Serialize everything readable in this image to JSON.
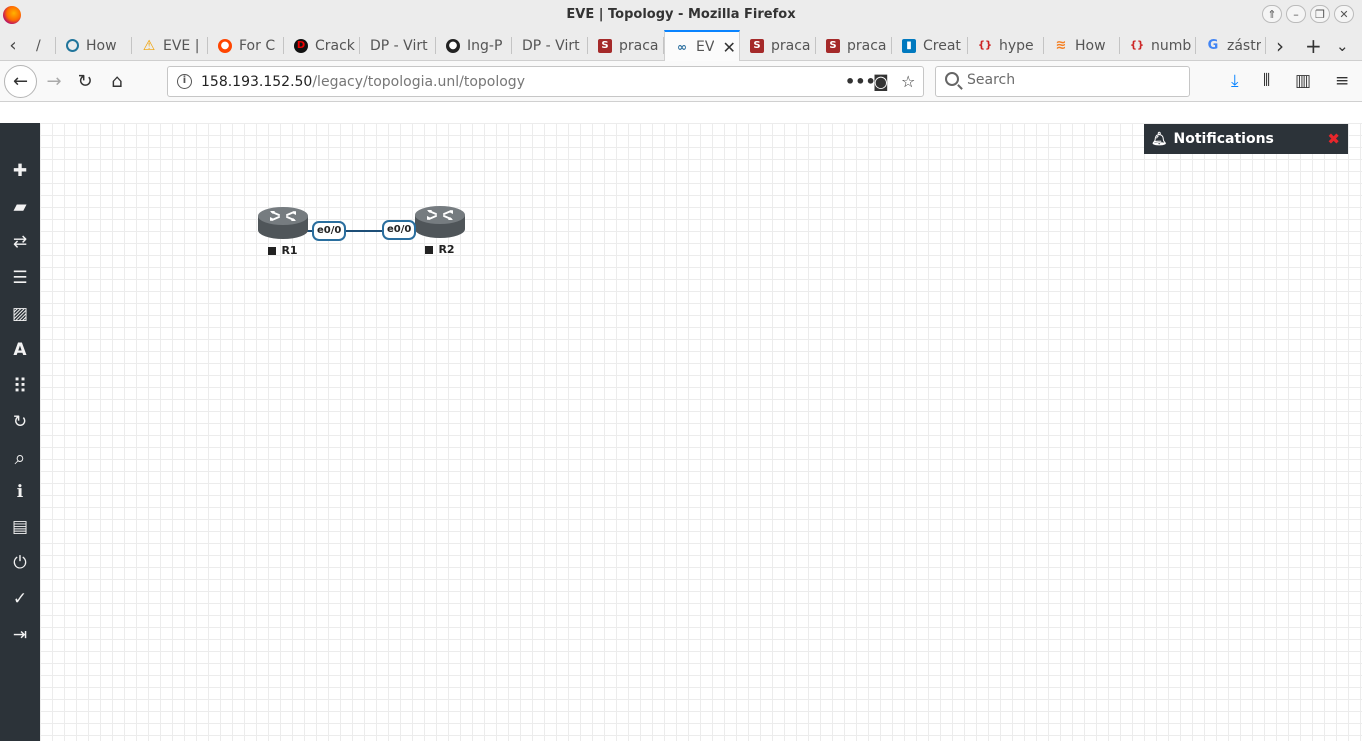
{
  "window": {
    "title": "EVE | Topology - Mozilla Firefox",
    "controls": [
      "⇑",
      "–",
      "❐",
      "✕"
    ]
  },
  "tabs": [
    {
      "label": "/",
      "favicon": "partial-icon",
      "color": "#888888"
    },
    {
      "label": "How",
      "favicon": "wordpress-icon",
      "color": "#21759b"
    },
    {
      "label": "EVE |",
      "favicon": "warning-icon",
      "color": "#f0a000"
    },
    {
      "label": "For C",
      "favicon": "reddit-icon",
      "color": "#ff4500"
    },
    {
      "label": "Crack",
      "favicon": "d-icon",
      "color": "#cc0000"
    },
    {
      "label": "DP - Virt",
      "favicon": "none",
      "color": ""
    },
    {
      "label": "Ing-P",
      "favicon": "github-icon",
      "color": "#222222"
    },
    {
      "label": "DP - Virt",
      "favicon": "none",
      "color": ""
    },
    {
      "label": "praca",
      "favicon": "s-icon",
      "color": "#a52a2a"
    },
    {
      "label": "EV",
      "favicon": "eve-icon",
      "color": "#2a6e9e",
      "active": true
    },
    {
      "label": "praca",
      "favicon": "s-icon",
      "color": "#a52a2a"
    },
    {
      "label": "praca",
      "favicon": "s-icon",
      "color": "#a52a2a"
    },
    {
      "label": "Creat",
      "favicon": "trello-icon",
      "color": "#0079bf"
    },
    {
      "label": "hype",
      "favicon": "braces-icon",
      "color": "#cc2222"
    },
    {
      "label": "How",
      "favicon": "stackoverflow-icon",
      "color": "#f48024"
    },
    {
      "label": "numb",
      "favicon": "braces-icon",
      "color": "#cc2222"
    },
    {
      "label": "zástr",
      "favicon": "google-icon",
      "color": "#4285f4"
    }
  ],
  "nav": {
    "url_host": "158.193.152.50",
    "url_path": "/legacy/topologia.unl/topology",
    "search_placeholder": "Search"
  },
  "sidebar": [
    {
      "name": "add-object-icon",
      "glyph": "✚"
    },
    {
      "name": "nodes-icon",
      "glyph": "▰"
    },
    {
      "name": "networks-icon",
      "glyph": "⇄"
    },
    {
      "name": "startup-configs-icon",
      "glyph": "☰"
    },
    {
      "name": "pictures-icon",
      "glyph": "▨"
    },
    {
      "name": "text-icon",
      "glyph": "A"
    },
    {
      "name": "status-grid-icon",
      "glyph": "⠿"
    },
    {
      "name": "refresh-icon",
      "glyph": "↻"
    },
    {
      "name": "zoom-icon",
      "glyph": "⌕"
    },
    {
      "name": "info-icon",
      "glyph": "ℹ"
    },
    {
      "name": "lab-details-icon",
      "glyph": "▤"
    },
    {
      "name": "power-icon",
      "glyph": "⏻"
    },
    {
      "name": "lock-lab-icon",
      "glyph": "✓"
    },
    {
      "name": "close-lab-icon",
      "glyph": "⇥"
    }
  ],
  "topology": {
    "nodes": [
      {
        "id": "r1",
        "label": "R1"
      },
      {
        "id": "r2",
        "label": "R2"
      }
    ],
    "interfaces": [
      {
        "node": "r1",
        "label": "e0/0"
      },
      {
        "node": "r2",
        "label": "e0/0"
      }
    ]
  },
  "notifications": {
    "title": "Notifications",
    "close": "✖"
  },
  "colors": {
    "sidebar_bg": "#2c3339",
    "link": "#1d4e77",
    "interface_border": "#2a6e9e",
    "notification_close": "#e8262b",
    "active_tab_accent": "#0a84ff"
  }
}
